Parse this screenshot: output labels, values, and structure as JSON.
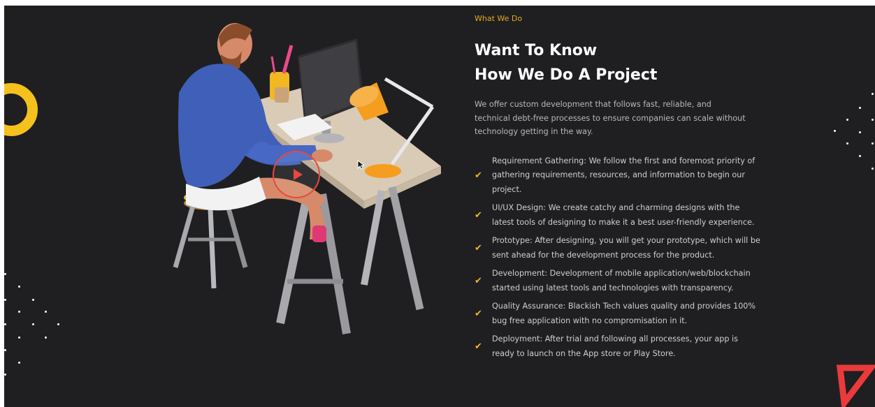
{
  "section": {
    "eyebrow": "What We Do",
    "headline_line1": "Want To Know",
    "headline_line2": "How We Do A Project",
    "intro": "We offer custom development that follows fast, reliable, and technical debt-free processes to ensure companies can scale without technology getting in the way."
  },
  "checklist": [
    "Requirement Gathering: We follow the first and foremost priority of gathering requirements, resources, and information to begin our project.",
    "UI/UX Design: We create catchy and charming designs with the latest tools of designing to make it a best user-friendly experience.",
    "Prototype: After designing, you will get your prototype, which will be sent ahead for the development process for the product.",
    "Development: Development of mobile application/web/blockchain started using latest tools and technologies with transparency.",
    "Quality Assurance: Blackish Tech values quality and provides 100% bug free application with no compromisation in it.",
    "Deployment: After trial and following all processes, your app is ready to launch on the App store or Play Store."
  ],
  "icons": {
    "check": "checkmark-icon",
    "play": "play-icon"
  },
  "colors": {
    "background": "#1f1f21",
    "accent_yellow": "#f2b721",
    "eyebrow": "#e5a823",
    "play_red": "#e8483f",
    "triangle_red": "#ea3a3c"
  }
}
